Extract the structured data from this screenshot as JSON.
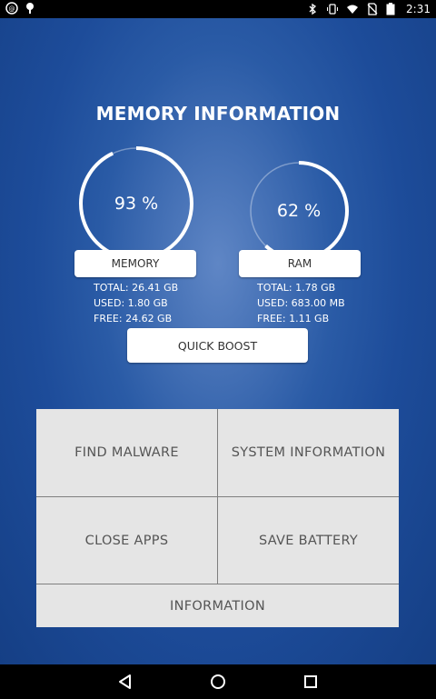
{
  "status_bar": {
    "time": "2:31",
    "left_icons": [
      "app-notification-icon",
      "debug-icon"
    ],
    "right_icons": [
      "bluetooth-icon",
      "vibrate-icon",
      "wifi-icon",
      "no-sim-icon",
      "battery-icon"
    ]
  },
  "header": {
    "title": "MEMORY INFORMATION"
  },
  "memory": {
    "percent_text": "93 %",
    "percent": 93,
    "button_label": "MEMORY",
    "total": "TOTAL: 26.41 GB",
    "used": "USED: 1.80 GB",
    "free": "FREE: 24.62 GB"
  },
  "ram": {
    "percent_text": "62 %",
    "percent": 62,
    "button_label": "RAM",
    "total": "TOTAL: 1.78 GB",
    "used": "USED: 683.00 MB",
    "free": "FREE: 1.11 GB"
  },
  "quick_boost": {
    "label": "QUICK BOOST"
  },
  "menu": {
    "find_malware": "FIND MALWARE",
    "system_information": "SYSTEM INFORMATION",
    "close_apps": "CLOSE APPS",
    "save_battery": "SAVE BATTERY",
    "information": "INFORMATION"
  },
  "nav": {
    "icons": [
      "back-icon",
      "home-icon",
      "recents-icon"
    ]
  },
  "colors": {
    "background_start": "#5f86c5",
    "background_end": "#153f85",
    "panel": "#e5e5e5",
    "text_white": "#ffffff"
  }
}
